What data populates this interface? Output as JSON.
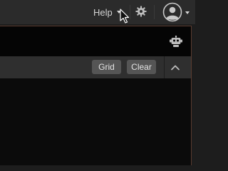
{
  "topbar": {
    "help_label": "Help",
    "icons": {
      "help_menu_caret": "caret-down",
      "settings": "gear",
      "account": "user-circle",
      "account_menu_caret": "caret-down"
    }
  },
  "command_bar": {
    "icons": {
      "assistant": "robot"
    }
  },
  "toolbar": {
    "grid_label": "Grid",
    "clear_label": "Clear",
    "icons": {
      "collapse": "chevron-up"
    }
  },
  "colors": {
    "background": "#1d1d1d",
    "command_bar_bg": "#050505",
    "toolbar_bg": "#2f2f2f",
    "output_bg": "#0b0b0b",
    "button_bg": "#555555",
    "border_accent": "#5a3b2f",
    "text": "#d4d4d4"
  }
}
